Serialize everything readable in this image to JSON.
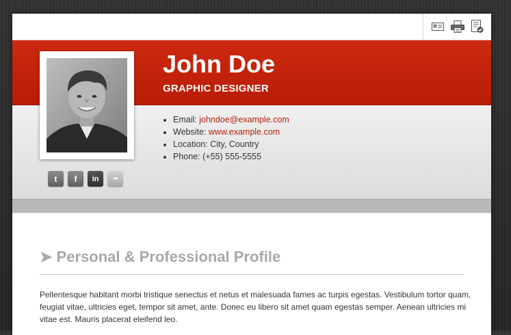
{
  "toolbar": {
    "icons": [
      "vcard-icon",
      "print-icon",
      "download-document-icon"
    ]
  },
  "profile": {
    "name": "John Doe",
    "title": "GRAPHIC DESIGNER",
    "contact": {
      "email_label": "Email:",
      "email": "johndoe@example.com",
      "website_label": "Website:",
      "website": "www.example.com",
      "location_label": "Location:",
      "location": "City, Country",
      "phone_label": "Phone:",
      "phone": "(+55) 555-5555"
    },
    "socials": [
      {
        "name": "twitter",
        "glyph": "t"
      },
      {
        "name": "facebook",
        "glyph": "f"
      },
      {
        "name": "linkedin",
        "glyph": "in"
      },
      {
        "name": "flickr",
        "glyph": "●●"
      }
    ]
  },
  "section": {
    "arrow": "➤",
    "title": "Personal & Professional Profile",
    "text": "Pellentesque habitant morbi tristique senectus et netus et malesuada fames ac turpis egestas. Vestibulum tortor quam, feugiat vitae, ultricies eget, tempor sit amet, ante. Donec eu libero sit amet quam egestas semper. Aenean ultricies mi vitae est. Mauris placerat eleifend leo."
  },
  "colors": {
    "accent_red": "#c0230a",
    "link_red": "#b8200a",
    "heading_grey": "#a8a8a8"
  }
}
